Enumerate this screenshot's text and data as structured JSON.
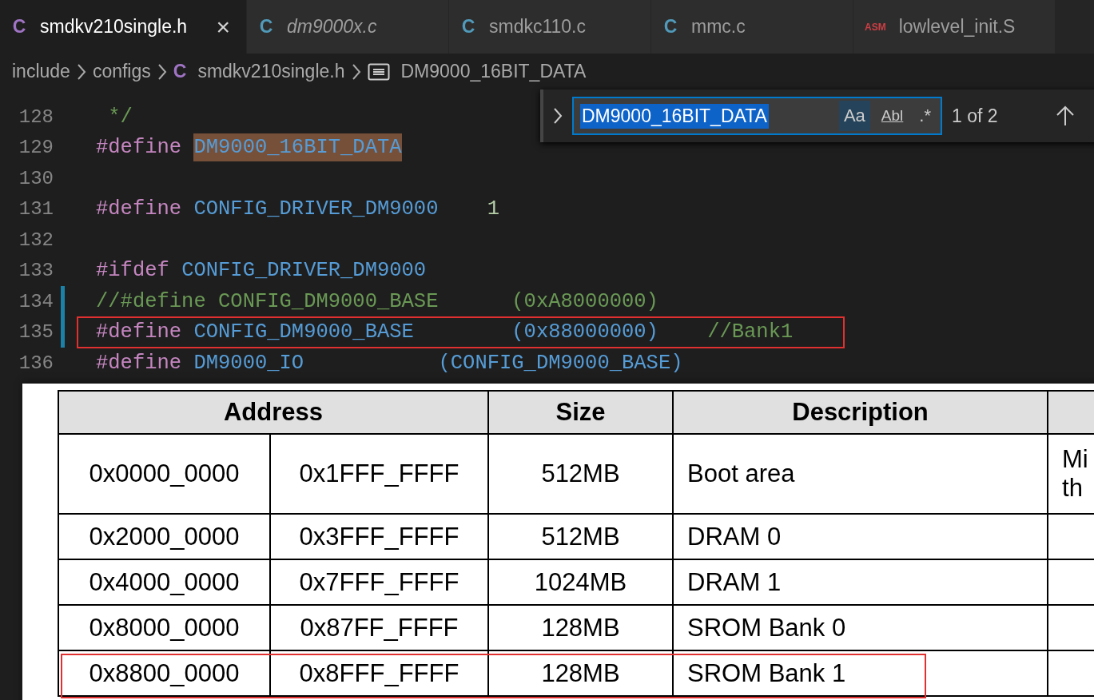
{
  "tabs": [
    {
      "icon": "C",
      "color": "#a074c4",
      "label": "smdkv210single.h",
      "selected": true,
      "italic": false,
      "close": "×"
    },
    {
      "icon": "C",
      "color": "#519aba",
      "label": "dm9000x.c",
      "selected": false,
      "italic": true
    },
    {
      "icon": "C",
      "color": "#519aba",
      "label": "smdkc110.c",
      "selected": false,
      "italic": false
    },
    {
      "icon": "C",
      "color": "#519aba",
      "label": "mmc.c",
      "selected": false,
      "italic": false
    },
    {
      "icon": "ASM",
      "color": "#cc3e44",
      "label": "lowlevel_init.S",
      "selected": false,
      "italic": false
    }
  ],
  "breadcrumb": [
    {
      "kind": "folder",
      "label": "include"
    },
    {
      "kind": "folder",
      "label": "configs"
    },
    {
      "kind": "file",
      "icon": "C",
      "color": "#a074c4",
      "label": "smdkv210single.h"
    },
    {
      "kind": "symbol",
      "label": "DM9000_16BIT_DATA"
    }
  ],
  "find_widget": {
    "value": "DM9000_16BIT_DATA",
    "match_case": "Aa",
    "match_case_on": true,
    "whole_word": "Abl",
    "regex": ".*",
    "count": "1 of 2"
  },
  "code_lines": [
    {
      "number": "128",
      "modified": false,
      "highlighted": false,
      "tokens": [
        {
          "kind": "comment",
          "text": " */"
        }
      ]
    },
    {
      "number": "129",
      "modified": false,
      "highlighted": false,
      "tokens": [
        {
          "kind": "keyword",
          "text": "#define "
        },
        {
          "kind": "macro",
          "text": "DM9000_16BIT_DATA",
          "match": true
        }
      ]
    },
    {
      "number": "130",
      "modified": false,
      "highlighted": false
    },
    {
      "number": "131",
      "modified": false,
      "highlighted": false,
      "tokens": [
        {
          "kind": "keyword",
          "text": "#define "
        },
        {
          "kind": "macro",
          "text": "CONFIG_DRIVER_DM9000    "
        },
        {
          "kind": "number",
          "text": "1"
        }
      ]
    },
    {
      "number": "132",
      "modified": false,
      "highlighted": false
    },
    {
      "number": "133",
      "modified": false,
      "highlighted": false,
      "tokens": [
        {
          "kind": "keyword",
          "text": "#ifdef "
        },
        {
          "kind": "macro",
          "text": "CONFIG_DRIVER_DM9000"
        }
      ]
    },
    {
      "number": "134",
      "modified": true,
      "highlighted": false,
      "tokens": [
        {
          "kind": "comment",
          "text": "//#define CONFIG_DM9000_BASE      (0xA8000000)"
        }
      ]
    },
    {
      "number": "135",
      "modified": true,
      "highlighted": true,
      "tokens": [
        {
          "kind": "keyword",
          "text": "#define "
        },
        {
          "kind": "macro",
          "text": "CONFIG_DM9000_BASE        (0x88000000)    "
        },
        {
          "kind": "comment",
          "text": "//Bank1"
        }
      ]
    },
    {
      "number": "136",
      "modified": false,
      "highlighted": false,
      "tokens": [
        {
          "kind": "keyword",
          "text": "#define "
        },
        {
          "kind": "macro",
          "text": "DM9000_IO           (CONFIG_DM9000_BASE)"
        }
      ]
    }
  ],
  "memory_map": {
    "columns": [
      "Address",
      "Size",
      "Description"
    ],
    "rows": [
      {
        "start": "0x0000_0000",
        "end": "0x1FFF_FFFF",
        "size": "512MB",
        "description": "Boot area",
        "column_5": [
          "Mi",
          "th"
        ],
        "highlighted": false
      },
      {
        "start": "0x2000_0000",
        "end": "0x3FFF_FFFF",
        "size": "512MB",
        "description": "DRAM 0",
        "highlighted": false
      },
      {
        "start": "0x4000_0000",
        "end": "0x7FFF_FFFF",
        "size": "1024MB",
        "description": "DRAM 1",
        "highlighted": false
      },
      {
        "start": "0x8000_0000",
        "end": "0x87FF_FFFF",
        "size": "128MB",
        "description": "SROM Bank 0",
        "highlighted": false
      },
      {
        "start": "0x8800_0000",
        "end": "0x8FFF_FFFF",
        "size": "128MB",
        "description": "SROM Bank 1",
        "highlighted": true
      }
    ]
  }
}
